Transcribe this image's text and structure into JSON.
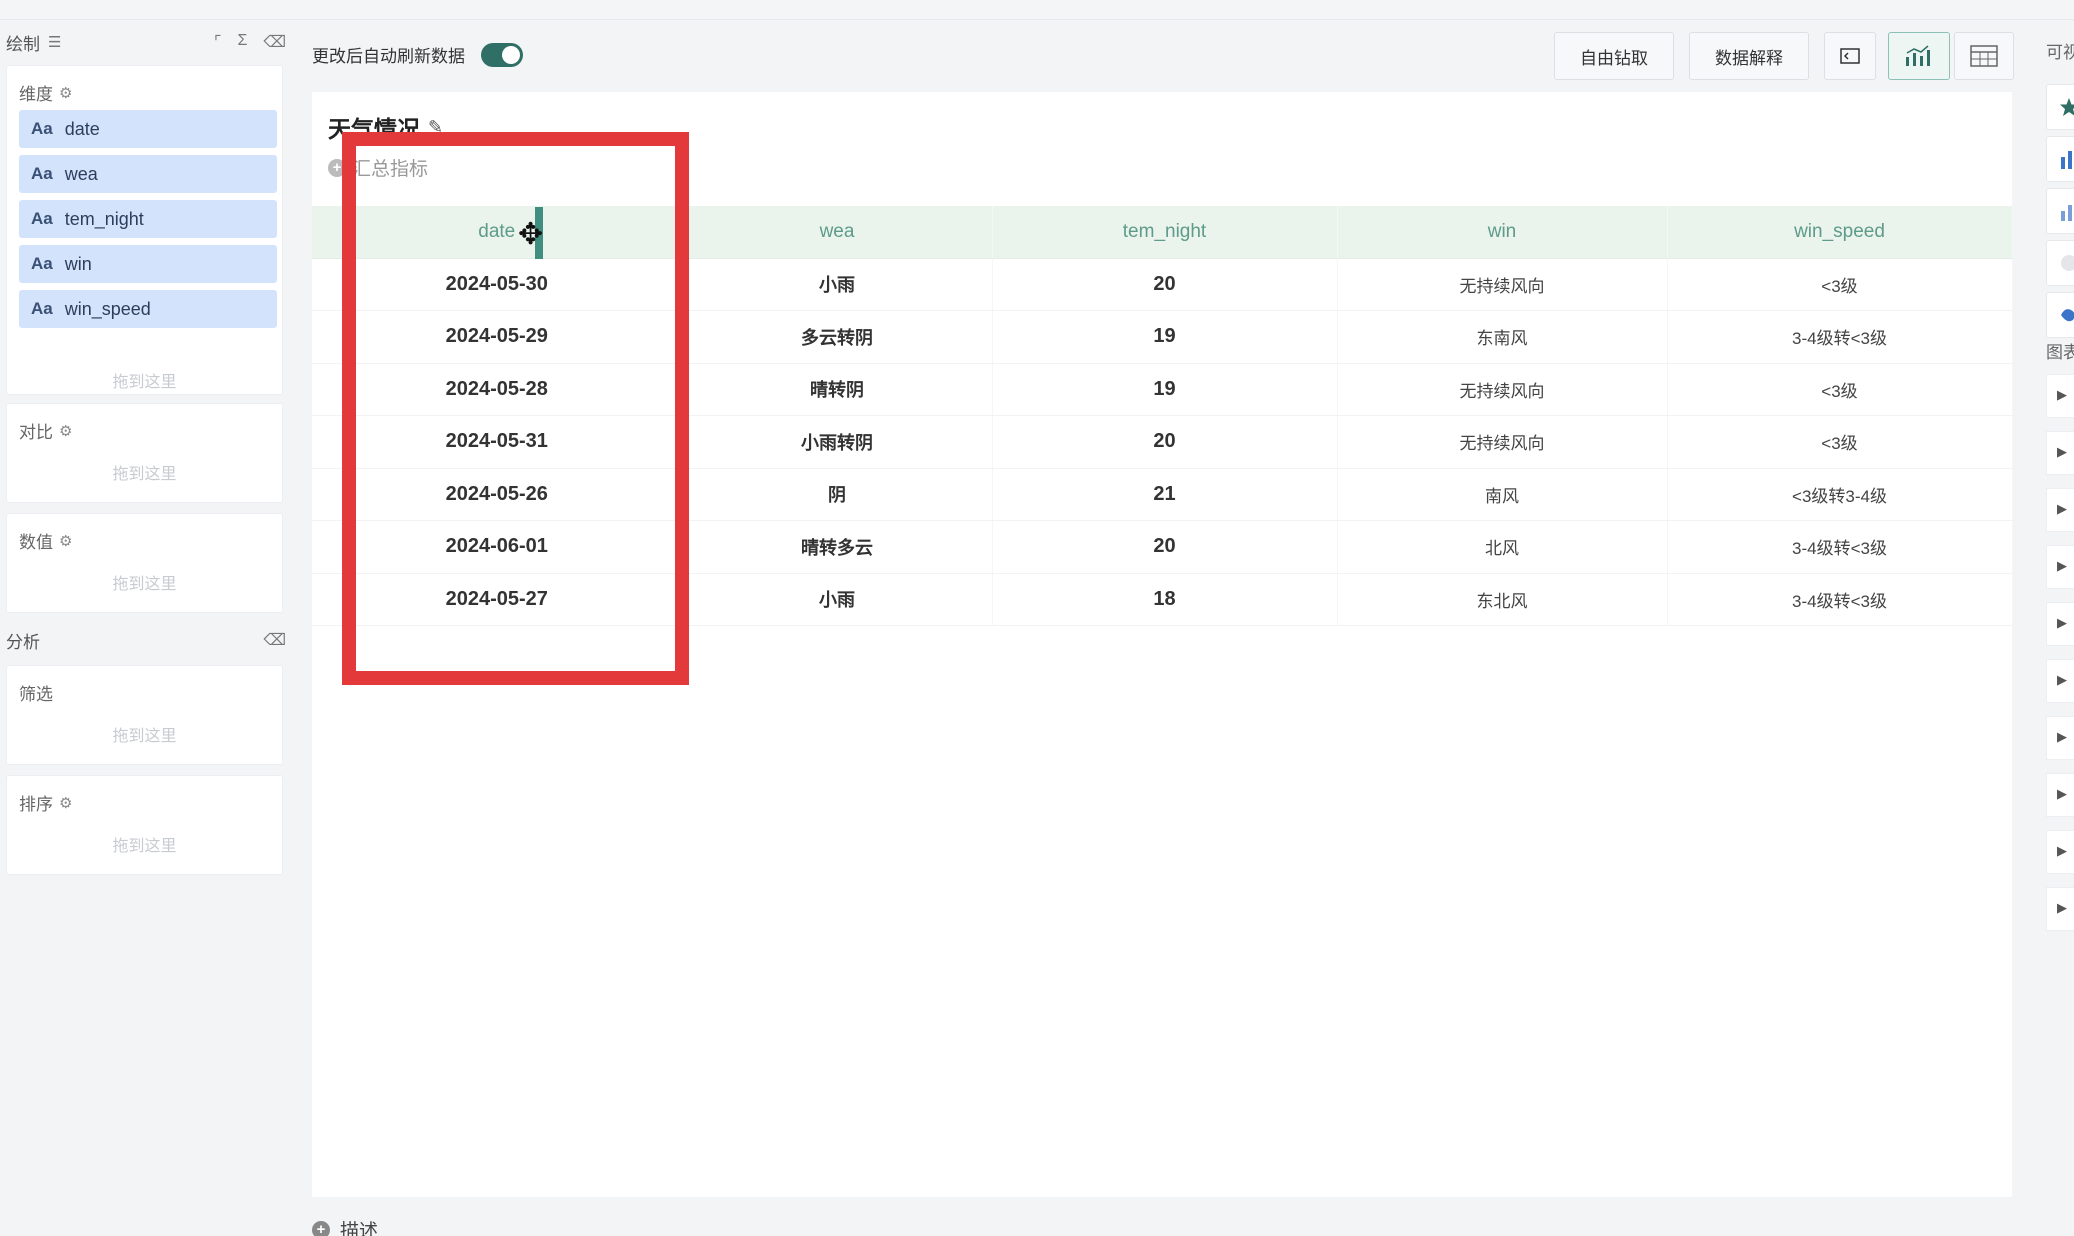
{
  "left_panel": {
    "draw_label": "绘制",
    "dimension": {
      "title": "维度",
      "items": [
        "date",
        "wea",
        "tem_night",
        "win",
        "win_speed"
      ],
      "type_badge": "Aa",
      "drop_hint": "拖到这里"
    },
    "compare": {
      "title": "对比",
      "drop_hint": "拖到这里"
    },
    "value": {
      "title": "数值",
      "drop_hint": "拖到这里"
    },
    "analysis_label": "分析",
    "filter": {
      "title": "筛选",
      "drop_hint": "拖到这里"
    },
    "sort": {
      "title": "排序",
      "drop_hint": "拖到这里"
    }
  },
  "toolbar": {
    "auto_refresh_label": "更改后自动刷新数据",
    "auto_refresh_on": true,
    "drill_label": "自由钻取",
    "explain_label": "数据解释"
  },
  "chart": {
    "title": "天气情况",
    "summary_label": "汇总指标",
    "columns": [
      "date",
      "wea",
      "tem_night",
      "win",
      "win_speed"
    ],
    "rows": [
      [
        "2024-05-30",
        "小雨",
        "20",
        "无持续风向",
        "<3级"
      ],
      [
        "2024-05-29",
        "多云转阴",
        "19",
        "东南风",
        "3-4级转<3级"
      ],
      [
        "2024-05-28",
        "晴转阴",
        "19",
        "无持续风向",
        "<3级"
      ],
      [
        "2024-05-31",
        "小雨转阴",
        "20",
        "无持续风向",
        "<3级"
      ],
      [
        "2024-05-26",
        "阴",
        "21",
        "南风",
        "<3级转3-4级"
      ],
      [
        "2024-06-01",
        "晴转多云",
        "20",
        "北风",
        "3-4级转<3级"
      ],
      [
        "2024-05-27",
        "小雨",
        "18",
        "东北风",
        "3-4级转<3级"
      ]
    ],
    "description_label": "描述"
  },
  "right_panel": {
    "top_label": "可视",
    "section_label": "图表"
  },
  "colors": {
    "accent": "#2f6f66",
    "header_bg": "#eaf4ec",
    "header_text": "#5e9b8a",
    "pill_bg": "#d3e3fb",
    "highlight": "#e4393b"
  }
}
